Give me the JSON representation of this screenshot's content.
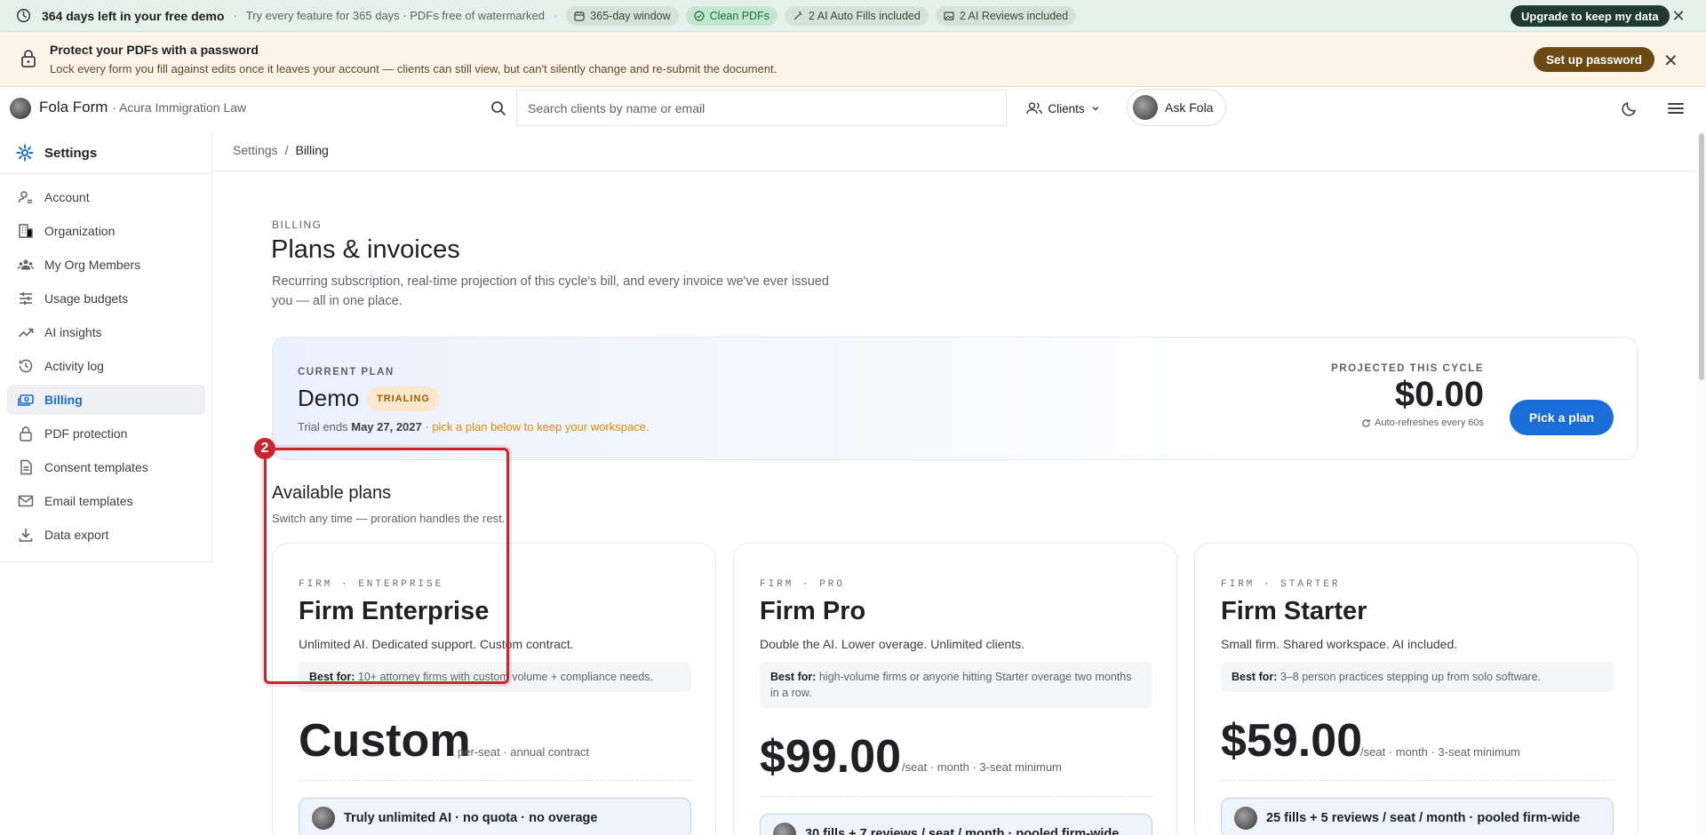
{
  "demo_bar": {
    "title": "364 days left in your free demo",
    "subtitle": "Try every feature for 365 days · PDFs free of watermarked",
    "chips": [
      "365-day window",
      "Clean PDFs",
      "2 AI Auto Fills included",
      "2 AI Reviews included"
    ],
    "upgrade_label": "Upgrade to keep my data",
    "close": "✕"
  },
  "password_banner": {
    "title": "Protect your PDFs with a password",
    "subtitle": "Lock every form you fill against edits once it leaves your account — clients can still view, but can't silently change and re-submit the document.",
    "button": "Set up password",
    "close": "✕"
  },
  "header": {
    "brand": "Fola Form",
    "org": "· Acura Immigration Law",
    "search_placeholder": "Search clients by name or email",
    "clients_label": "Clients",
    "ask_label": "Ask Fola"
  },
  "sidebar": {
    "title": "Settings",
    "items": [
      {
        "label": "Account",
        "icon": "person-icon"
      },
      {
        "label": "Organization",
        "icon": "building-icon"
      },
      {
        "label": "My Org Members",
        "icon": "group-icon"
      },
      {
        "label": "Usage budgets",
        "icon": "sliders-icon"
      },
      {
        "label": "AI insights",
        "icon": "trend-icon"
      },
      {
        "label": "Activity log",
        "icon": "history-icon"
      },
      {
        "label": "Billing",
        "icon": "billing-icon",
        "active": true
      },
      {
        "label": "PDF protection",
        "icon": "lock-icon"
      },
      {
        "label": "Consent templates",
        "icon": "doc-icon"
      },
      {
        "label": "Email templates",
        "icon": "mail-icon"
      },
      {
        "label": "Data export",
        "icon": "download-icon"
      }
    ]
  },
  "breadcrumb": {
    "parent": "Settings",
    "separator": "/",
    "current": "Billing"
  },
  "page": {
    "eyebrow": "BILLING",
    "title": "Plans & invoices",
    "description": "Recurring subscription, real-time projection of this cycle's bill, and every invoice we've ever issued you — all in one place."
  },
  "current_plan": {
    "label": "CURRENT PLAN",
    "name": "Demo",
    "badge": "TRIALING",
    "trial_prefix": "Trial ends",
    "trial_date": "May 27, 2027",
    "trial_suffix": "· pick a plan below to keep your workspace.",
    "projected_label": "PROJECTED THIS CYCLE",
    "projected_value": "$0.00",
    "refresh_note": "Auto-refreshes every 60s",
    "pick_button": "Pick a plan"
  },
  "available": {
    "title": "Available plans",
    "subtitle": "Switch any time — proration handles the rest.",
    "annotation_number": "2"
  },
  "tiers": [
    {
      "eyebrow": "FIRM · ENTERPRISE",
      "name": "Firm Enterprise",
      "description": "Unlimited AI. Dedicated support. Custom contract.",
      "best_for_label": "Best for:",
      "best_for": "10+ attorney firms with custom volume + compliance needs.",
      "price": "Custom",
      "unit": "per-seat · annual contract",
      "quota": "Truly unlimited AI · no quota · no overage"
    },
    {
      "eyebrow": "FIRM · PRO",
      "name": "Firm Pro",
      "description": "Double the AI. Lower overage. Unlimited clients.",
      "best_for_label": "Best for:",
      "best_for": "high-volume firms or anyone hitting Starter overage two months in a row.",
      "price": "$99.00",
      "unit": "/seat · month · 3-seat minimum",
      "quota": "30 fills + 7 reviews / seat / month · pooled firm-wide"
    },
    {
      "eyebrow": "FIRM · STARTER",
      "name": "Firm Starter",
      "description": "Small firm. Shared workspace. AI included.",
      "best_for_label": "Best for:",
      "best_for": "3–8 person practices stepping up from solo software.",
      "price": "$59.00",
      "unit": "/seat · month · 3-seat minimum",
      "quota": "25 fills + 5 reviews / seat / month · pooled firm-wide"
    }
  ]
}
